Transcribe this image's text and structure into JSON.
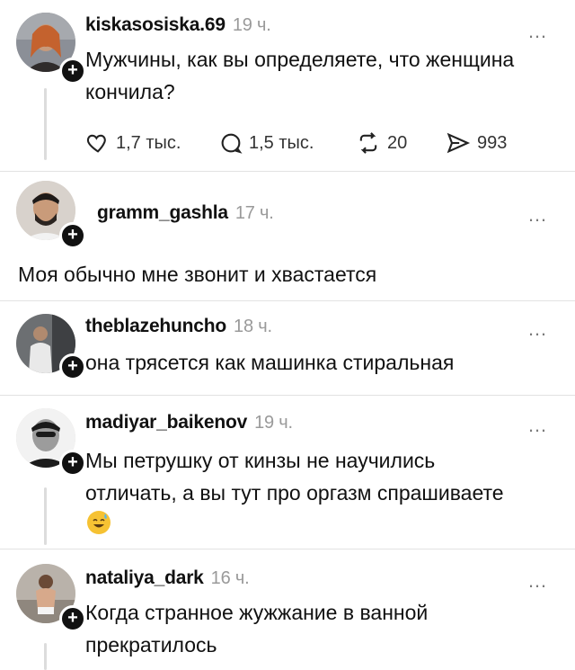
{
  "posts": [
    {
      "username": "kiskasosiska.69",
      "time": "19 ч.",
      "text_lines": [
        "Мужчины, как вы определяете, что женщина",
        "кончила?"
      ],
      "actions": {
        "likes": "1,7 тыс.",
        "replies": "1,5 тыс.",
        "reposts": "20",
        "shares": "993"
      }
    },
    {
      "username": "gramm_gashla",
      "time": "17 ч.",
      "text_lines": [
        "Моя обычно мне звонит и хвастается"
      ]
    },
    {
      "username": "theblazehuncho",
      "time": "18 ч.",
      "text_lines": [
        "она трясется как машинка стиральная"
      ]
    },
    {
      "username": "madiyar_baikenov",
      "time": "19 ч.",
      "text_lines": [
        "Мы петрушку от кинзы не научились",
        "отличать, а вы тут про оргазм спрашиваете"
      ],
      "emoji": "smiling-face-with-sweat-icon"
    },
    {
      "username": "nataliya_dark",
      "time": "16 ч.",
      "text_lines": [
        "Когда странное жужжание в ванной",
        "прекратилось"
      ]
    }
  ],
  "icons": {
    "more": "…",
    "plus": "+"
  },
  "colors": {
    "text": "#111111",
    "muted": "#9a9a9a",
    "divider": "#e2e2e2",
    "thread_line": "#dcdcdc",
    "badge": "#111111"
  }
}
